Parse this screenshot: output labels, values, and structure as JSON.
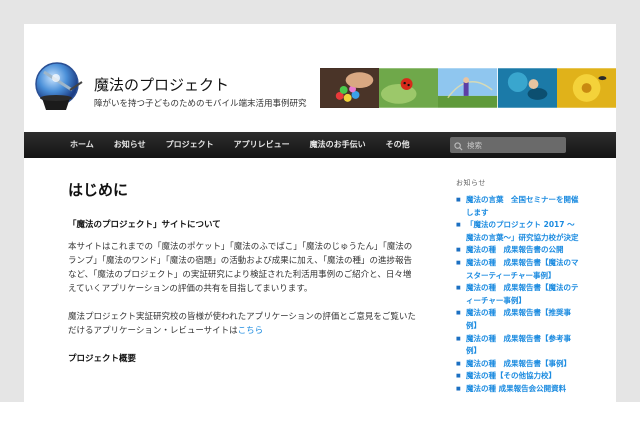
{
  "site": {
    "title": "魔法のプロジェクト",
    "description": "障がいを持つ子どものためのモバイル端末活用事例研究"
  },
  "nav": {
    "items": [
      "ホーム",
      "お知らせ",
      "プロジェクト",
      "アプリレビュー",
      "魔法のお手伝い",
      "その他"
    ],
    "search_placeholder": "検索"
  },
  "main": {
    "page_title": "はじめに",
    "section1_title": "「魔法のプロジェクト」サイトについて",
    "para1": "本サイトはこれまでの「魔法のポケット」「魔法のふでばこ」「魔法のじゅうたん」「魔法のランプ」「魔法のワンド」「魔法の宿題」の活動および成果に加え、「魔法の種」の進捗報告など、「魔法のプロジェクト」の実証研究により検証された利活用事例のご紹介と、日々増えていくアプリケーションの評価の共有を目指してまいります。",
    "para2_text": "魔法プロジェクト実証研究校の皆様が使われたアプリケーションの評価とご意見をご覧いただけるアプリケーション・レビューサイトは",
    "para2_link": "こちら",
    "section2_title": "プロジェクト概要"
  },
  "sidebar": {
    "heading": "お知らせ",
    "items": [
      "魔法の言葉　全国セミナーを開催します",
      "「魔法のプロジェクト 2017 〜魔法の言葉〜」研究協力校が決定",
      "魔法の種　成果報告書の公開",
      "魔法の種　成果報告書【魔法のマスターティーチャー事例】",
      "魔法の種　成果報告書【魔法のティーチャー事例】",
      "魔法の種　成果報告書【推奨事例】",
      "魔法の種　成果報告書【参考事例】",
      "魔法の種　成果報告書【事例】",
      "魔法の種【その他協力校】",
      "魔法の種 成果報告会公開資料"
    ]
  },
  "colors": {
    "nav_bg": "#1f1f1f",
    "link": "#1b8be0",
    "page_bg": "#e5e5e5"
  }
}
